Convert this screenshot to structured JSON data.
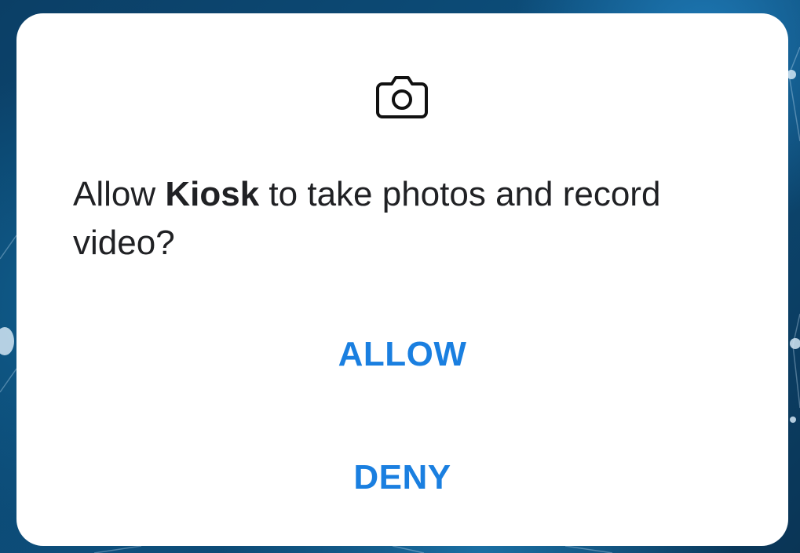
{
  "permission_dialog": {
    "icon": "camera-icon",
    "message_prefix": "Allow ",
    "app_name": "Kiosk",
    "message_suffix": " to take photos and record video?",
    "allow_label": "ALLOW",
    "deny_label": "DENY"
  },
  "colors": {
    "accent": "#1a7fe0",
    "text": "#202124",
    "dialog_background": "#ffffff",
    "wallpaper": "#0b3f66"
  }
}
